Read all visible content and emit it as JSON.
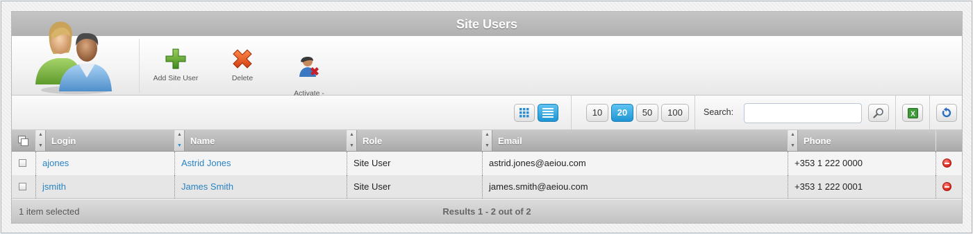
{
  "window": {
    "title": "Site Users"
  },
  "toolbar": {
    "buttons": [
      {
        "label": "Add Site User",
        "icon": "plus-icon"
      },
      {
        "label": "Delete",
        "icon": "x-icon"
      },
      {
        "label": "Activate -\nDeactivate",
        "icon": "user-x-icon"
      }
    ]
  },
  "view_modes": {
    "grid": "grid-icon",
    "list": "list-icon",
    "active": "list"
  },
  "page_size": {
    "options": [
      "10",
      "20",
      "50",
      "100"
    ],
    "selected": "20"
  },
  "search": {
    "label": "Search:",
    "value": "",
    "placeholder": ""
  },
  "table": {
    "columns": [
      "Login",
      "Name",
      "Role",
      "Email",
      "Phone"
    ],
    "rows": [
      {
        "login": "ajones",
        "name": "Astrid Jones",
        "role": "Site User",
        "email": "astrid.jones@aeiou.com",
        "phone": "+353 1 222 0000"
      },
      {
        "login": "jsmith",
        "name": "James Smith",
        "role": "Site User",
        "email": "james.smith@aeiou.com",
        "phone": "+353 1 222 0001"
      }
    ]
  },
  "footer": {
    "selection": "1 item selected",
    "results": "Results 1 - 2 out of 2"
  },
  "colors": {
    "accent": "#2a83c2",
    "active_button": "#1f95d3",
    "title_bar": "#b8b8b8"
  }
}
